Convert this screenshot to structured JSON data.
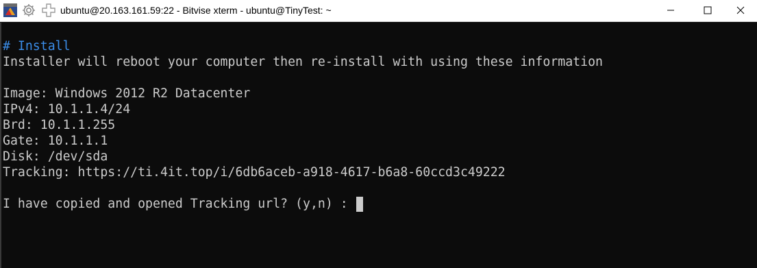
{
  "window": {
    "title": "ubuntu@20.163.161.59:22 - Bitvise xterm - ubuntu@TinyTest: ~"
  },
  "colors": {
    "terminal_background": "#0c0c0c",
    "terminal_text": "#cccccc",
    "comment_text": "#3b8eea",
    "titlebar_background": "#ffffff"
  },
  "icons": {
    "app": "bitvise-app-icon",
    "settings": "gear-icon",
    "new_session": "plus-icon",
    "minimize": "minimize-icon",
    "maximize": "maximize-icon",
    "close": "close-icon"
  },
  "terminal": {
    "lines": [
      "# Install",
      "Installer will reboot your computer then re-install with using these information",
      "",
      "Image: Windows 2012 R2 Datacenter",
      "IPv4: 10.1.1.4/24",
      "Brd: 10.1.1.255",
      "Gate: 10.1.1.1",
      "Disk: /dev/sda",
      "Tracking: https://ti.4it.top/i/6db6aceb-a918-4617-b6a8-60ccd3c49222",
      "",
      "I have copied and opened Tracking url? (y,n) : "
    ]
  }
}
